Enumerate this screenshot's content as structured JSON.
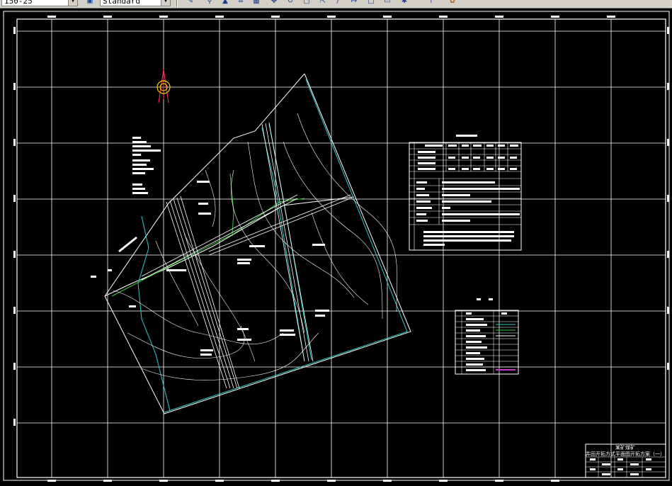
{
  "toolbar": {
    "scale_value": "150-25",
    "style_value": "Standard",
    "icons": [
      "paint-brush-icon",
      "matchprop-icon",
      "triangle-icon",
      "layer-icon",
      "grid-icon",
      "move-icon",
      "rotate-icon",
      "scale-box-icon",
      "stretch-icon",
      "pencil-icon",
      "measure-icon",
      "rectangle-icon",
      "rectangle-alt-icon",
      "gear-icon",
      "pointer-icon",
      "palette-icon"
    ]
  },
  "title_block": {
    "line1": "某矿煤矿",
    "line2": "井田开拓方式平面图开拓方案（一）"
  },
  "colors": {
    "background": "#000000",
    "line": "#ffffff",
    "cyan": "#33cccc",
    "green": "#33cc33",
    "compass": "#ff3355"
  }
}
